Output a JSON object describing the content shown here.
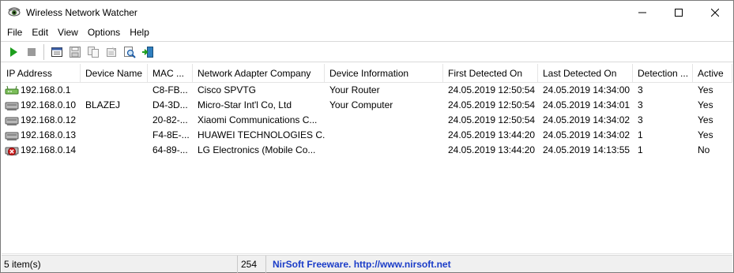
{
  "window": {
    "title": "Wireless Network Watcher"
  },
  "menu": [
    "File",
    "Edit",
    "View",
    "Options",
    "Help"
  ],
  "toolbar": {
    "icons": [
      "play-icon",
      "stop-icon",
      "html-report-icon",
      "save-icon",
      "copy-icon",
      "properties-icon",
      "find-icon",
      "exit-icon"
    ]
  },
  "table": {
    "columns": [
      "IP Address",
      "Device Name",
      "MAC ...",
      "Network Adapter Company",
      "Device Information",
      "First Detected On",
      "Last Detected On",
      "Detection ...",
      "Active"
    ],
    "rows": [
      {
        "icon": "router",
        "ip": "192.168.0.1",
        "name": "",
        "mac": "C8-FB...",
        "company": "Cisco SPVTG",
        "info": "Your Router",
        "first": "24.05.2019 12:50:54",
        "last": "24.05.2019 14:34:00",
        "count": "3",
        "active": "Yes"
      },
      {
        "icon": "computer",
        "ip": "192.168.0.10",
        "name": "BLAZEJ",
        "mac": "D4-3D...",
        "company": "Micro-Star Int'l Co, Ltd",
        "info": "Your Computer",
        "first": "24.05.2019 12:50:54",
        "last": "24.05.2019 14:34:01",
        "count": "3",
        "active": "Yes"
      },
      {
        "icon": "device",
        "ip": "192.168.0.12",
        "name": "",
        "mac": "20-82-...",
        "company": "Xiaomi Communications C...",
        "info": "",
        "first": "24.05.2019 12:50:54",
        "last": "24.05.2019 14:34:02",
        "count": "3",
        "active": "Yes"
      },
      {
        "icon": "device",
        "ip": "192.168.0.13",
        "name": "",
        "mac": "F4-8E-...",
        "company": "HUAWEI TECHNOLOGIES C...",
        "info": "",
        "first": "24.05.2019 13:44:20",
        "last": "24.05.2019 14:34:02",
        "count": "1",
        "active": "Yes"
      },
      {
        "icon": "device-inactive",
        "ip": "192.168.0.14",
        "name": "",
        "mac": "64-89-...",
        "company": "LG Electronics (Mobile Co...",
        "info": "",
        "first": "24.05.2019 13:44:20",
        "last": "24.05.2019 14:13:55",
        "count": "1",
        "active": "No"
      }
    ]
  },
  "status": {
    "items": "5 item(s)",
    "count": "254",
    "credit": "NirSoft Freeware.  http://www.nirsoft.net"
  },
  "colors": {
    "play": "#1e9e1e",
    "link": "#1a3cc8",
    "inactive": "#d42020"
  }
}
